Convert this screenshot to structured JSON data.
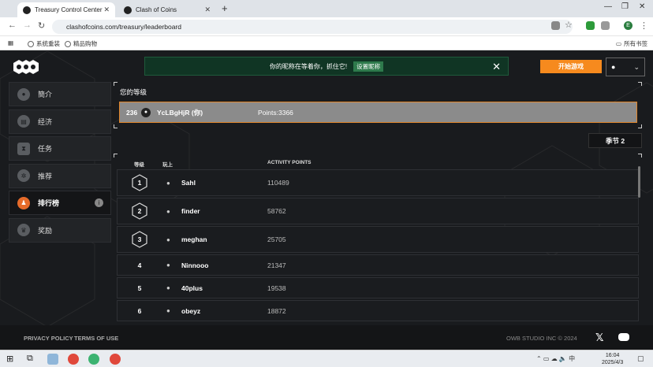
{
  "browser": {
    "tabs": [
      {
        "title": "Treasury Control Center",
        "active": true
      },
      {
        "title": "Clash of Coins",
        "active": false
      }
    ],
    "url": "clashofcoins.com/treasury/leaderboard",
    "bookmarks": [
      "系统重装",
      "精品购物"
    ],
    "all_bookmarks": "所有书签",
    "profile_initial": "E"
  },
  "banner": {
    "message": "你的昵称在等着你，抓住它!",
    "action": "设置昵称"
  },
  "header": {
    "start_game": "开始游戏"
  },
  "sidebar": {
    "items": [
      {
        "label": "簡介",
        "icon": "person-icon",
        "active": false
      },
      {
        "label": "经济",
        "icon": "wallet-icon",
        "active": false
      },
      {
        "label": "任务",
        "icon": "task-icon",
        "active": false
      },
      {
        "label": "推荐",
        "icon": "referral-icon",
        "active": false
      },
      {
        "label": "排行榜",
        "icon": "leaderboard-icon",
        "active": true
      },
      {
        "label": "奖励",
        "icon": "trophy-icon",
        "active": false
      }
    ]
  },
  "my_rank": {
    "title": "您的等级",
    "rank": "236",
    "name": "YcLBgHjR (你)",
    "points": "Points:3366"
  },
  "season": "季节 2",
  "leaderboard": {
    "headers": {
      "rank": "等级",
      "player": "玩上",
      "points": "ACTIVITY POINTS"
    },
    "rows": [
      {
        "rank": "1",
        "name": "Sahl",
        "points": "110489"
      },
      {
        "rank": "2",
        "name": "finder",
        "points": "58762"
      },
      {
        "rank": "3",
        "name": "meghan",
        "points": "25705"
      },
      {
        "rank": "4",
        "name": "Ninnooo",
        "points": "21347"
      },
      {
        "rank": "5",
        "name": "40plus",
        "points": "19538"
      },
      {
        "rank": "6",
        "name": "obeyz",
        "points": "18872"
      }
    ]
  },
  "footer": {
    "privacy": "PRIVACY POLICY",
    "terms": "TERMS OF USE",
    "copyright": "OWB STUDIO INC © 2024"
  },
  "taskbar": {
    "time": "16:04",
    "date": "2025/4/3"
  },
  "colors": {
    "accent": "#f68a1e",
    "banner_bg": "#103524",
    "active_icon": "#e66b2a"
  }
}
